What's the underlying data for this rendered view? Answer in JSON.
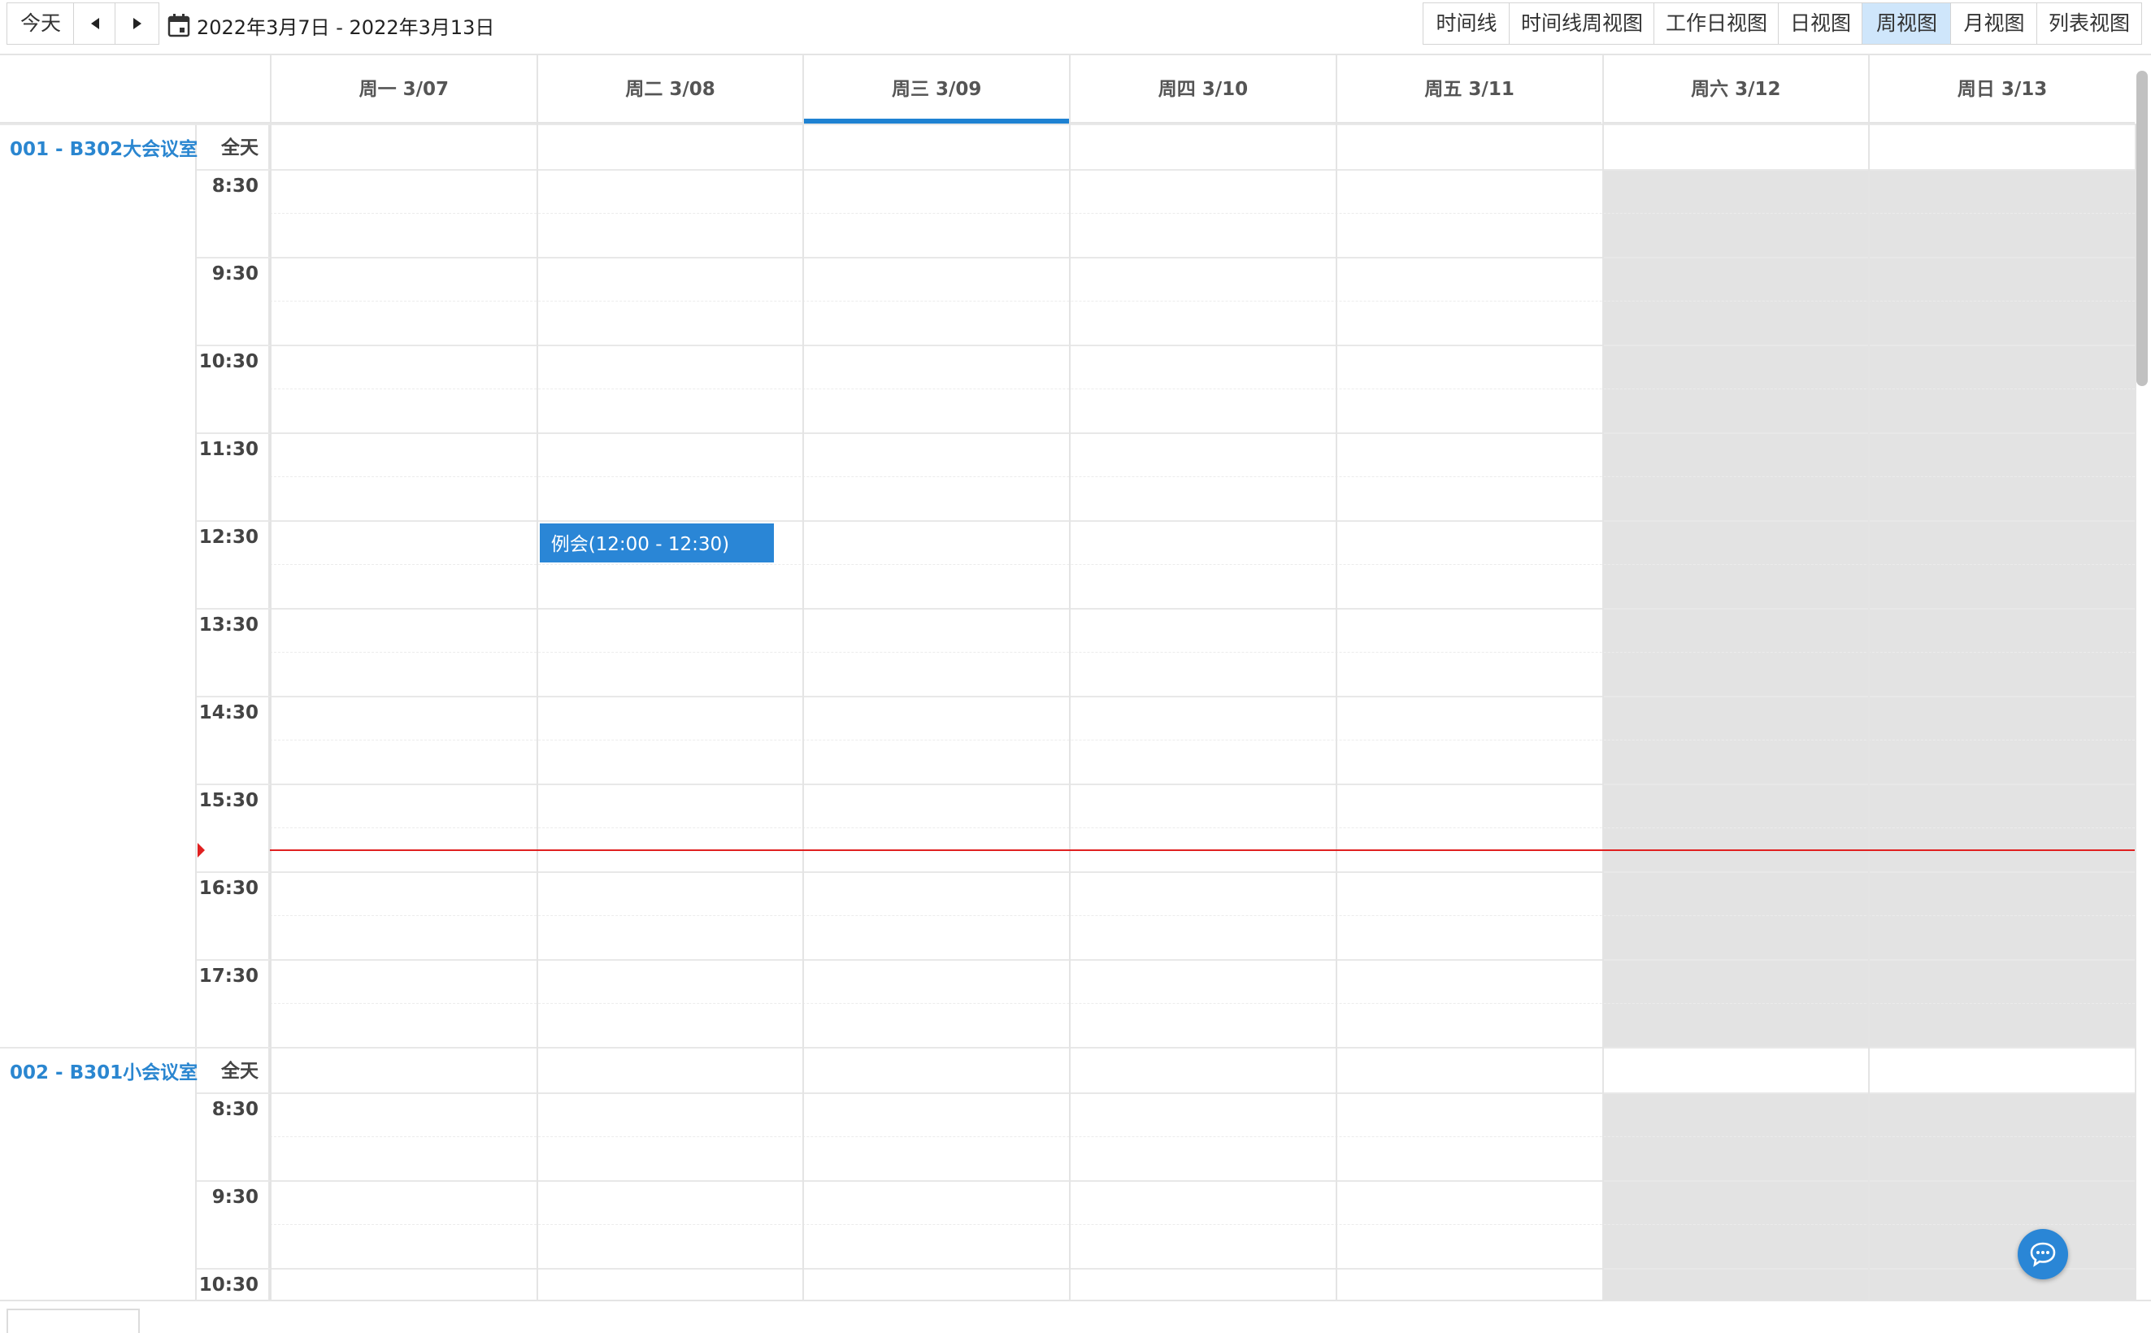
{
  "toolbar": {
    "today_label": "今天",
    "date_range": "2022年3月7日 - 2022年3月13日",
    "views": [
      {
        "label": "时间线",
        "active": false
      },
      {
        "label": "时间线周视图",
        "active": false
      },
      {
        "label": "工作日视图",
        "active": false
      },
      {
        "label": "日视图",
        "active": false
      },
      {
        "label": "周视图",
        "active": true
      },
      {
        "label": "月视图",
        "active": false
      },
      {
        "label": "列表视图",
        "active": false
      }
    ]
  },
  "days": [
    {
      "label": "周一 3/07",
      "today": false,
      "weekend": false
    },
    {
      "label": "周二 3/08",
      "today": false,
      "weekend": false
    },
    {
      "label": "周三 3/09",
      "today": true,
      "weekend": false
    },
    {
      "label": "周四 3/10",
      "today": false,
      "weekend": false
    },
    {
      "label": "周五 3/11",
      "today": false,
      "weekend": false
    },
    {
      "label": "周六 3/12",
      "today": false,
      "weekend": true
    },
    {
      "label": "周日 3/13",
      "today": false,
      "weekend": true
    }
  ],
  "all_day_label": "全天",
  "time_labels": [
    "8:30",
    "9:30",
    "10:30",
    "11:30",
    "12:30",
    "13:30",
    "14:30",
    "15:30",
    "16:30",
    "17:30"
  ],
  "resources": [
    {
      "name": "001 - B302大会议室",
      "visible_hours": 10
    },
    {
      "name": "002 - B301小会议室",
      "visible_hours": 3
    }
  ],
  "events": [
    {
      "title": "例会(12:00 - 12:30)",
      "resource": 0,
      "day": 1,
      "start_hour": 12.0,
      "end_hour": 12.5,
      "color": "#2a86d6"
    }
  ],
  "now_indicator": {
    "day_start_hour": 8.0,
    "hour": 15.75,
    "color": "#e02020"
  },
  "colors": {
    "accent": "#1e82d2",
    "weekend_bg": "#e3e3e3",
    "active_view_bg": "#cfe6fb"
  }
}
